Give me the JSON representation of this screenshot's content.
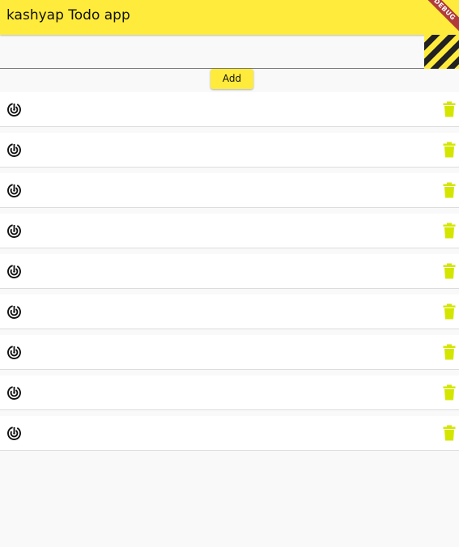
{
  "appbar": {
    "title": "kashyap Todo app",
    "debug_label": "DEBUG",
    "color": "#ffeb3b"
  },
  "input": {
    "value": "",
    "placeholder": ""
  },
  "add_button": {
    "label": "Add"
  },
  "todos": [
    {
      "text": "",
      "lead_icon": "radar-icon",
      "trail_icon": "delete-icon"
    },
    {
      "text": "",
      "lead_icon": "radar-icon",
      "trail_icon": "delete-icon"
    },
    {
      "text": "",
      "lead_icon": "radar-icon",
      "trail_icon": "delete-icon"
    },
    {
      "text": "",
      "lead_icon": "radar-icon",
      "trail_icon": "delete-icon"
    },
    {
      "text": "",
      "lead_icon": "radar-icon",
      "trail_icon": "delete-icon"
    },
    {
      "text": "",
      "lead_icon": "radar-icon",
      "trail_icon": "delete-icon"
    },
    {
      "text": "",
      "lead_icon": "radar-icon",
      "trail_icon": "delete-icon"
    },
    {
      "text": "",
      "lead_icon": "radar-icon",
      "trail_icon": "delete-icon"
    },
    {
      "text": "",
      "lead_icon": "radar-icon",
      "trail_icon": "delete-icon"
    }
  ],
  "colors": {
    "accent": "#ffeb3b",
    "delete": "#d4e600",
    "background": "#f9f9f9"
  }
}
